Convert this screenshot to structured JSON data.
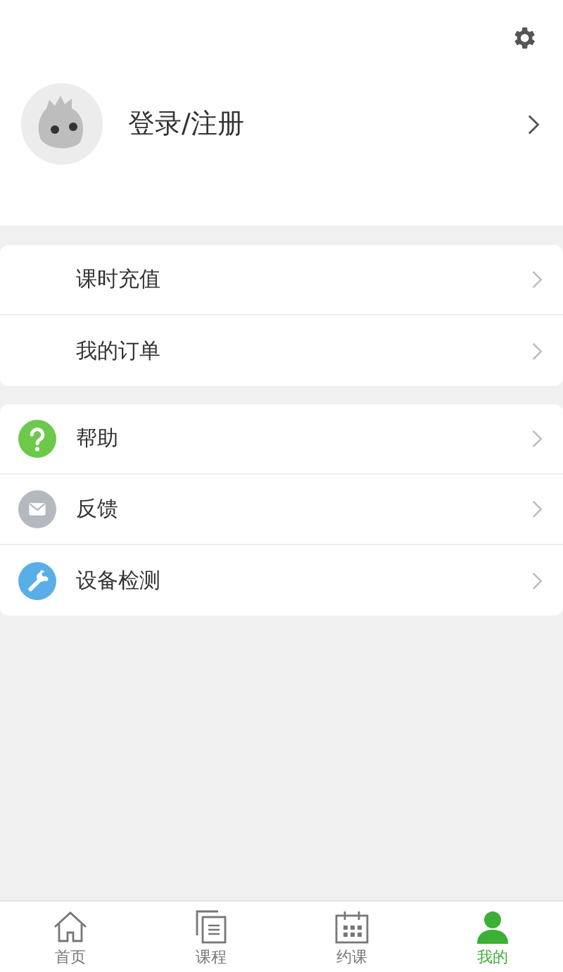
{
  "profile": {
    "login_label": "登录/注册"
  },
  "groups": [
    {
      "items": [
        {
          "label": "课时充值",
          "kind": "plain"
        },
        {
          "label": "我的订单",
          "kind": "plain"
        }
      ]
    },
    {
      "items": [
        {
          "label": "帮助",
          "kind": "help"
        },
        {
          "label": "反馈",
          "kind": "mail"
        },
        {
          "label": "设备检测",
          "kind": "tool"
        }
      ]
    }
  ],
  "tabs": [
    {
      "label": "首页",
      "kind": "home",
      "selected": false
    },
    {
      "label": "课程",
      "kind": "course",
      "selected": false
    },
    {
      "label": "约课",
      "kind": "calendar",
      "selected": false
    },
    {
      "label": "我的",
      "kind": "me",
      "selected": true
    }
  ]
}
